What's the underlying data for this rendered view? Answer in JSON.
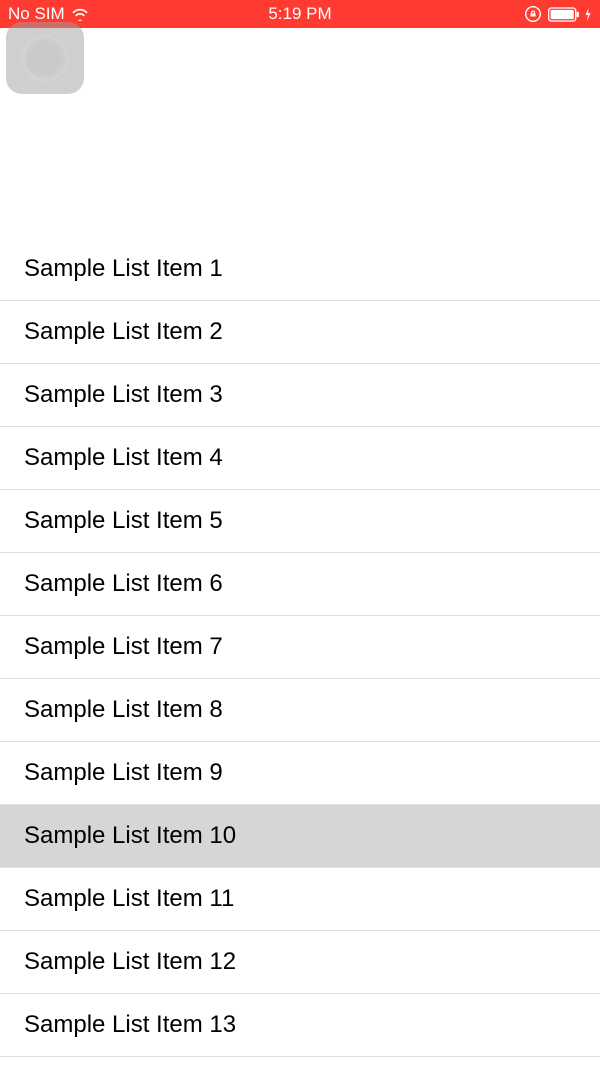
{
  "statusBar": {
    "carrier": "No SIM",
    "time": "5:19 PM"
  },
  "list": {
    "items": [
      {
        "label": "Sample List Item 1",
        "selected": false
      },
      {
        "label": "Sample List Item 2",
        "selected": false
      },
      {
        "label": "Sample List Item 3",
        "selected": false
      },
      {
        "label": "Sample List Item 4",
        "selected": false
      },
      {
        "label": "Sample List Item 5",
        "selected": false
      },
      {
        "label": "Sample List Item 6",
        "selected": false
      },
      {
        "label": "Sample List Item 7",
        "selected": false
      },
      {
        "label": "Sample List Item 8",
        "selected": false
      },
      {
        "label": "Sample List Item 9",
        "selected": false
      },
      {
        "label": "Sample List Item 10",
        "selected": true
      },
      {
        "label": "Sample List Item 11",
        "selected": false
      },
      {
        "label": "Sample List Item 12",
        "selected": false
      },
      {
        "label": "Sample List Item 13",
        "selected": false
      }
    ]
  }
}
